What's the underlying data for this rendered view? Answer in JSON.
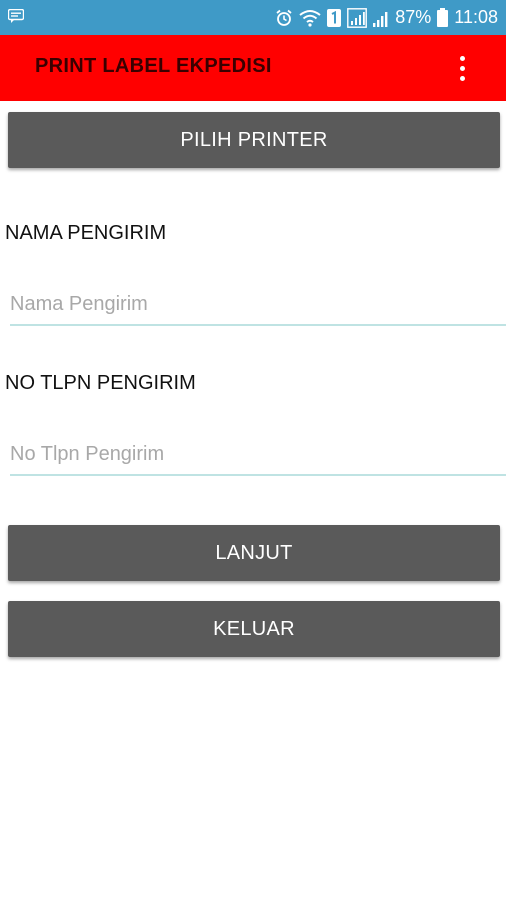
{
  "status_bar": {
    "battery": "87%",
    "time": "11:08"
  },
  "app_bar": {
    "title": "PRINT LABEL EKPEDISI"
  },
  "buttons": {
    "choose_printer": "PILIH PRINTER",
    "next": "LANJUT",
    "exit": "KELUAR"
  },
  "fields": {
    "sender_name": {
      "label": "NAMA PENGIRIM",
      "placeholder": "Nama Pengirim",
      "value": ""
    },
    "sender_phone": {
      "label": "NO TLPN PENGIRIM",
      "placeholder": "No Tlpn Pengirim",
      "value": ""
    }
  },
  "colors": {
    "status_bar": "#3f9ac7",
    "app_bar": "#ff0000",
    "app_title": "#3a0000",
    "button": "#5a5a5a",
    "input_underline": "#bfe3e3"
  },
  "icons": {
    "status_left": "message-notification-icon",
    "status_right": [
      "alarm-icon",
      "wifi-icon",
      "data-sim-icon",
      "signal-box-icon",
      "cell-signal-icon",
      "battery-icon"
    ],
    "app_bar": "overflow-menu-icon"
  }
}
